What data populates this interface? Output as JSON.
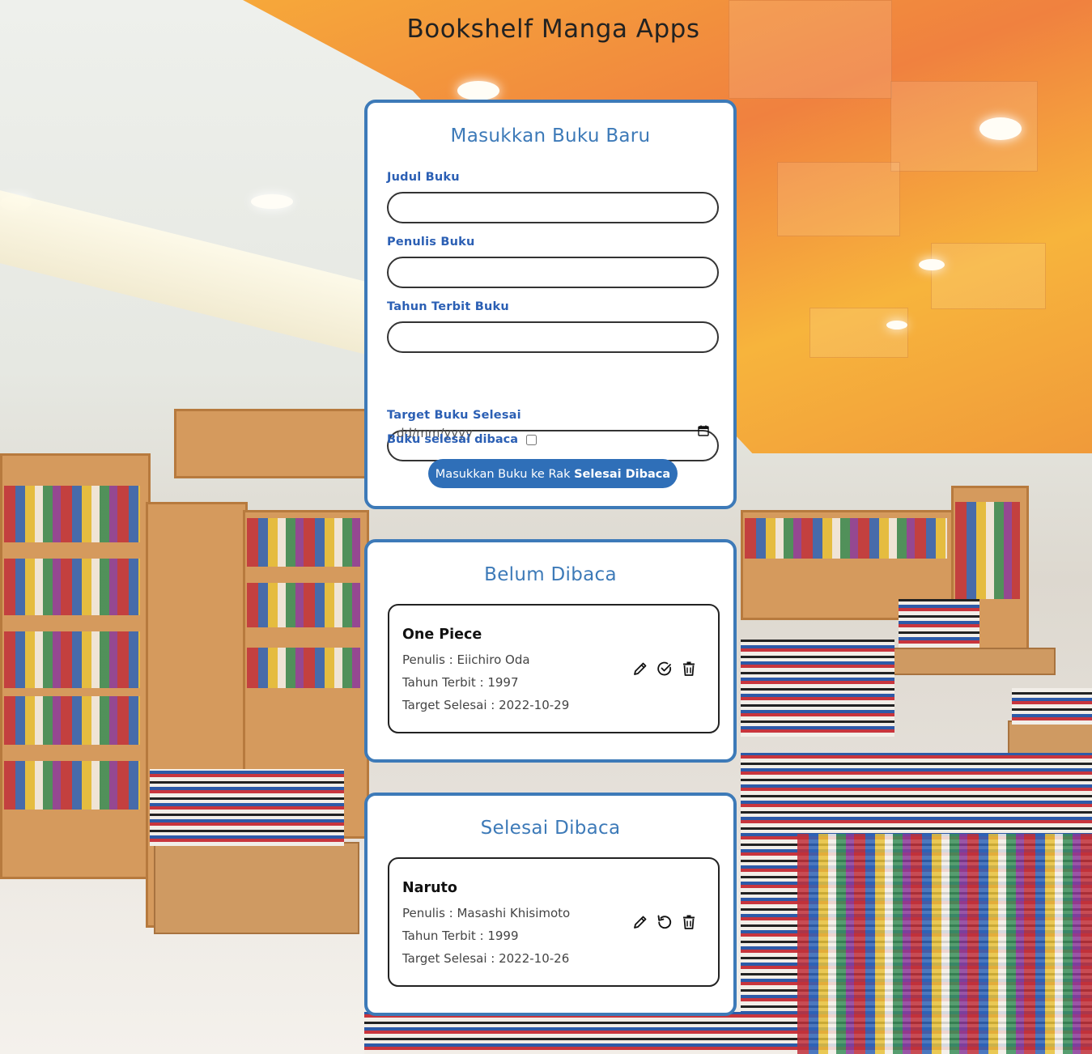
{
  "app": {
    "title": "Bookshelf Manga Apps"
  },
  "form": {
    "heading": "Masukkan Buku Baru",
    "fields": {
      "title_label": "Judul Buku",
      "title_value": "",
      "author_label": "Penulis Buku",
      "author_value": "",
      "year_label": "Tahun Terbit Buku",
      "year_value": "",
      "target_label": "Target Buku Selesai",
      "target_placeholder": "dd/mm/yyyy"
    },
    "checkbox_label": "Buku selesai dibaca",
    "checkbox_checked": false,
    "submit_prefix": "Masukkan Buku ke Rak ",
    "submit_shelf": "Selesai Dibaca"
  },
  "unread": {
    "heading": "Belum Dibaca",
    "books": [
      {
        "title": "One Piece",
        "author_line": "Penulis : Eiichiro Oda",
        "year_line": "Tahun Terbit : 1997",
        "target_line": "Target Selesai : 2022-10-29",
        "icons": [
          "pencil-icon",
          "check-circle-icon",
          "trash-icon"
        ]
      }
    ]
  },
  "read": {
    "heading": "Selesai Dibaca",
    "books": [
      {
        "title": "Naruto",
        "author_line": "Penulis : Masashi Khisimoto",
        "year_line": "Tahun Terbit : 1999",
        "target_line": "Target Selesai : 2022-10-26",
        "icons": [
          "pencil-icon",
          "undo-icon",
          "trash-icon"
        ]
      }
    ]
  },
  "colors": {
    "accent": "#3d7ab8",
    "label": "#2b5fb4",
    "button": "#2f6fb8"
  }
}
